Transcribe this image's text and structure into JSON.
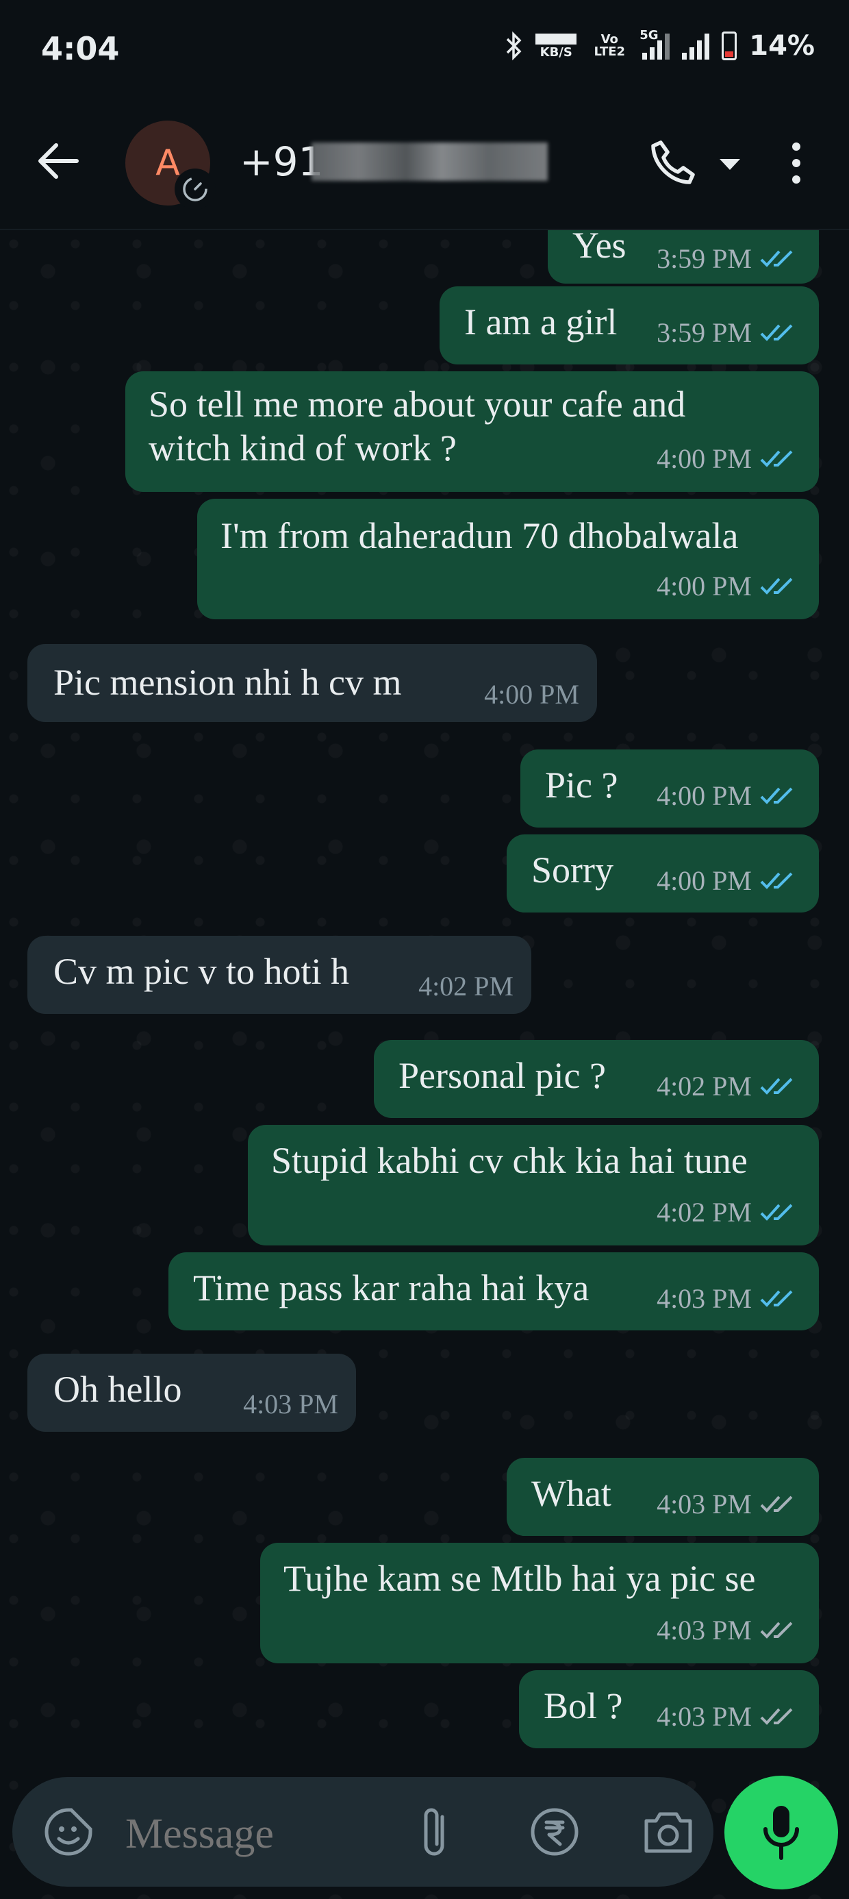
{
  "status_bar": {
    "time": "4:04",
    "net_speed_unit": "KB/S",
    "volte": "Vo LTE2",
    "network": "5G",
    "battery": "14%"
  },
  "header": {
    "avatar_initial": "A",
    "contact_number": "+91 "
  },
  "messages": [
    {
      "dir": "out",
      "text": "Yes",
      "time": "3:59 PM",
      "status": "read"
    },
    {
      "dir": "out",
      "text": "I am a girl",
      "time": "3:59 PM",
      "status": "read"
    },
    {
      "dir": "out",
      "text": "So tell me more about your cafe and\nwitch kind of work ?",
      "time": "4:00 PM",
      "status": "read"
    },
    {
      "dir": "out",
      "text": "I'm from daheradun 70 dhobalwala",
      "time": "4:00 PM",
      "status": "read"
    },
    {
      "dir": "in",
      "text": "Pic mension nhi h cv m",
      "time": "4:00 PM"
    },
    {
      "dir": "out",
      "text": "Pic ?",
      "time": "4:00 PM",
      "status": "read"
    },
    {
      "dir": "out",
      "text": "Sorry",
      "time": "4:00 PM",
      "status": "read"
    },
    {
      "dir": "in",
      "text": "Cv m pic v to hoti h",
      "time": "4:02 PM"
    },
    {
      "dir": "out",
      "text": "Personal pic ?",
      "time": "4:02 PM",
      "status": "read"
    },
    {
      "dir": "out",
      "text": "Stupid kabhi cv chk kia hai tune",
      "time": "4:02 PM",
      "status": "read"
    },
    {
      "dir": "out",
      "text": "Time pass kar raha hai kya",
      "time": "4:03 PM",
      "status": "read"
    },
    {
      "dir": "in",
      "text": "Oh hello",
      "time": "4:03 PM"
    },
    {
      "dir": "out",
      "text": "What",
      "time": "4:03 PM",
      "status": "delivered"
    },
    {
      "dir": "out",
      "text": "Tujhe kam se Mtlb hai ya pic se",
      "time": "4:03 PM",
      "status": "delivered"
    },
    {
      "dir": "out",
      "text": "Bol ?",
      "time": "4:03 PM",
      "status": "delivered"
    }
  ],
  "composer": {
    "placeholder": "Message"
  },
  "colors": {
    "outgoing_bubble": "#144d37",
    "incoming_bubble": "#202c33",
    "read_tick": "#53bdeb",
    "delivered_tick": "#a7b2ba",
    "mic_button": "#25d366",
    "avatar_text": "#ff8a65"
  },
  "icons": {
    "back": "arrow-left-icon",
    "call": "phone-icon",
    "dropdown": "chevron-down-icon",
    "more": "vertical-dots-icon",
    "emoji": "sticker-smiley-icon",
    "attach": "paperclip-icon",
    "payment": "rupee-icon",
    "camera": "camera-icon",
    "mic": "microphone-icon"
  }
}
